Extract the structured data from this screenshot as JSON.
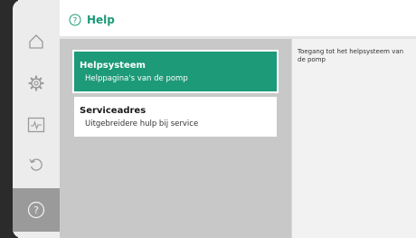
{
  "header": {
    "title": "Help",
    "icon": "help-circle-icon",
    "accent_color": "#1d9a78"
  },
  "sidebar": {
    "items": [
      {
        "name": "home",
        "icon": "home-icon",
        "active": false
      },
      {
        "name": "settings",
        "icon": "gear-icon",
        "active": false
      },
      {
        "name": "diagnostics",
        "icon": "pulse-monitor-icon",
        "active": false
      },
      {
        "name": "restore",
        "icon": "undo-icon",
        "active": false
      },
      {
        "name": "help",
        "icon": "help-circle-icon",
        "active": true
      }
    ]
  },
  "menu": {
    "items": [
      {
        "title": "Helpsysteem",
        "subtitle": "Helppagina's van de pomp",
        "selected": true
      },
      {
        "title": "Serviceadres",
        "subtitle": "Uitgebreidere hulp bij service",
        "selected": false
      }
    ]
  },
  "info_panel": {
    "text": "Toegang tot het helpsysteem van de pomp"
  }
}
